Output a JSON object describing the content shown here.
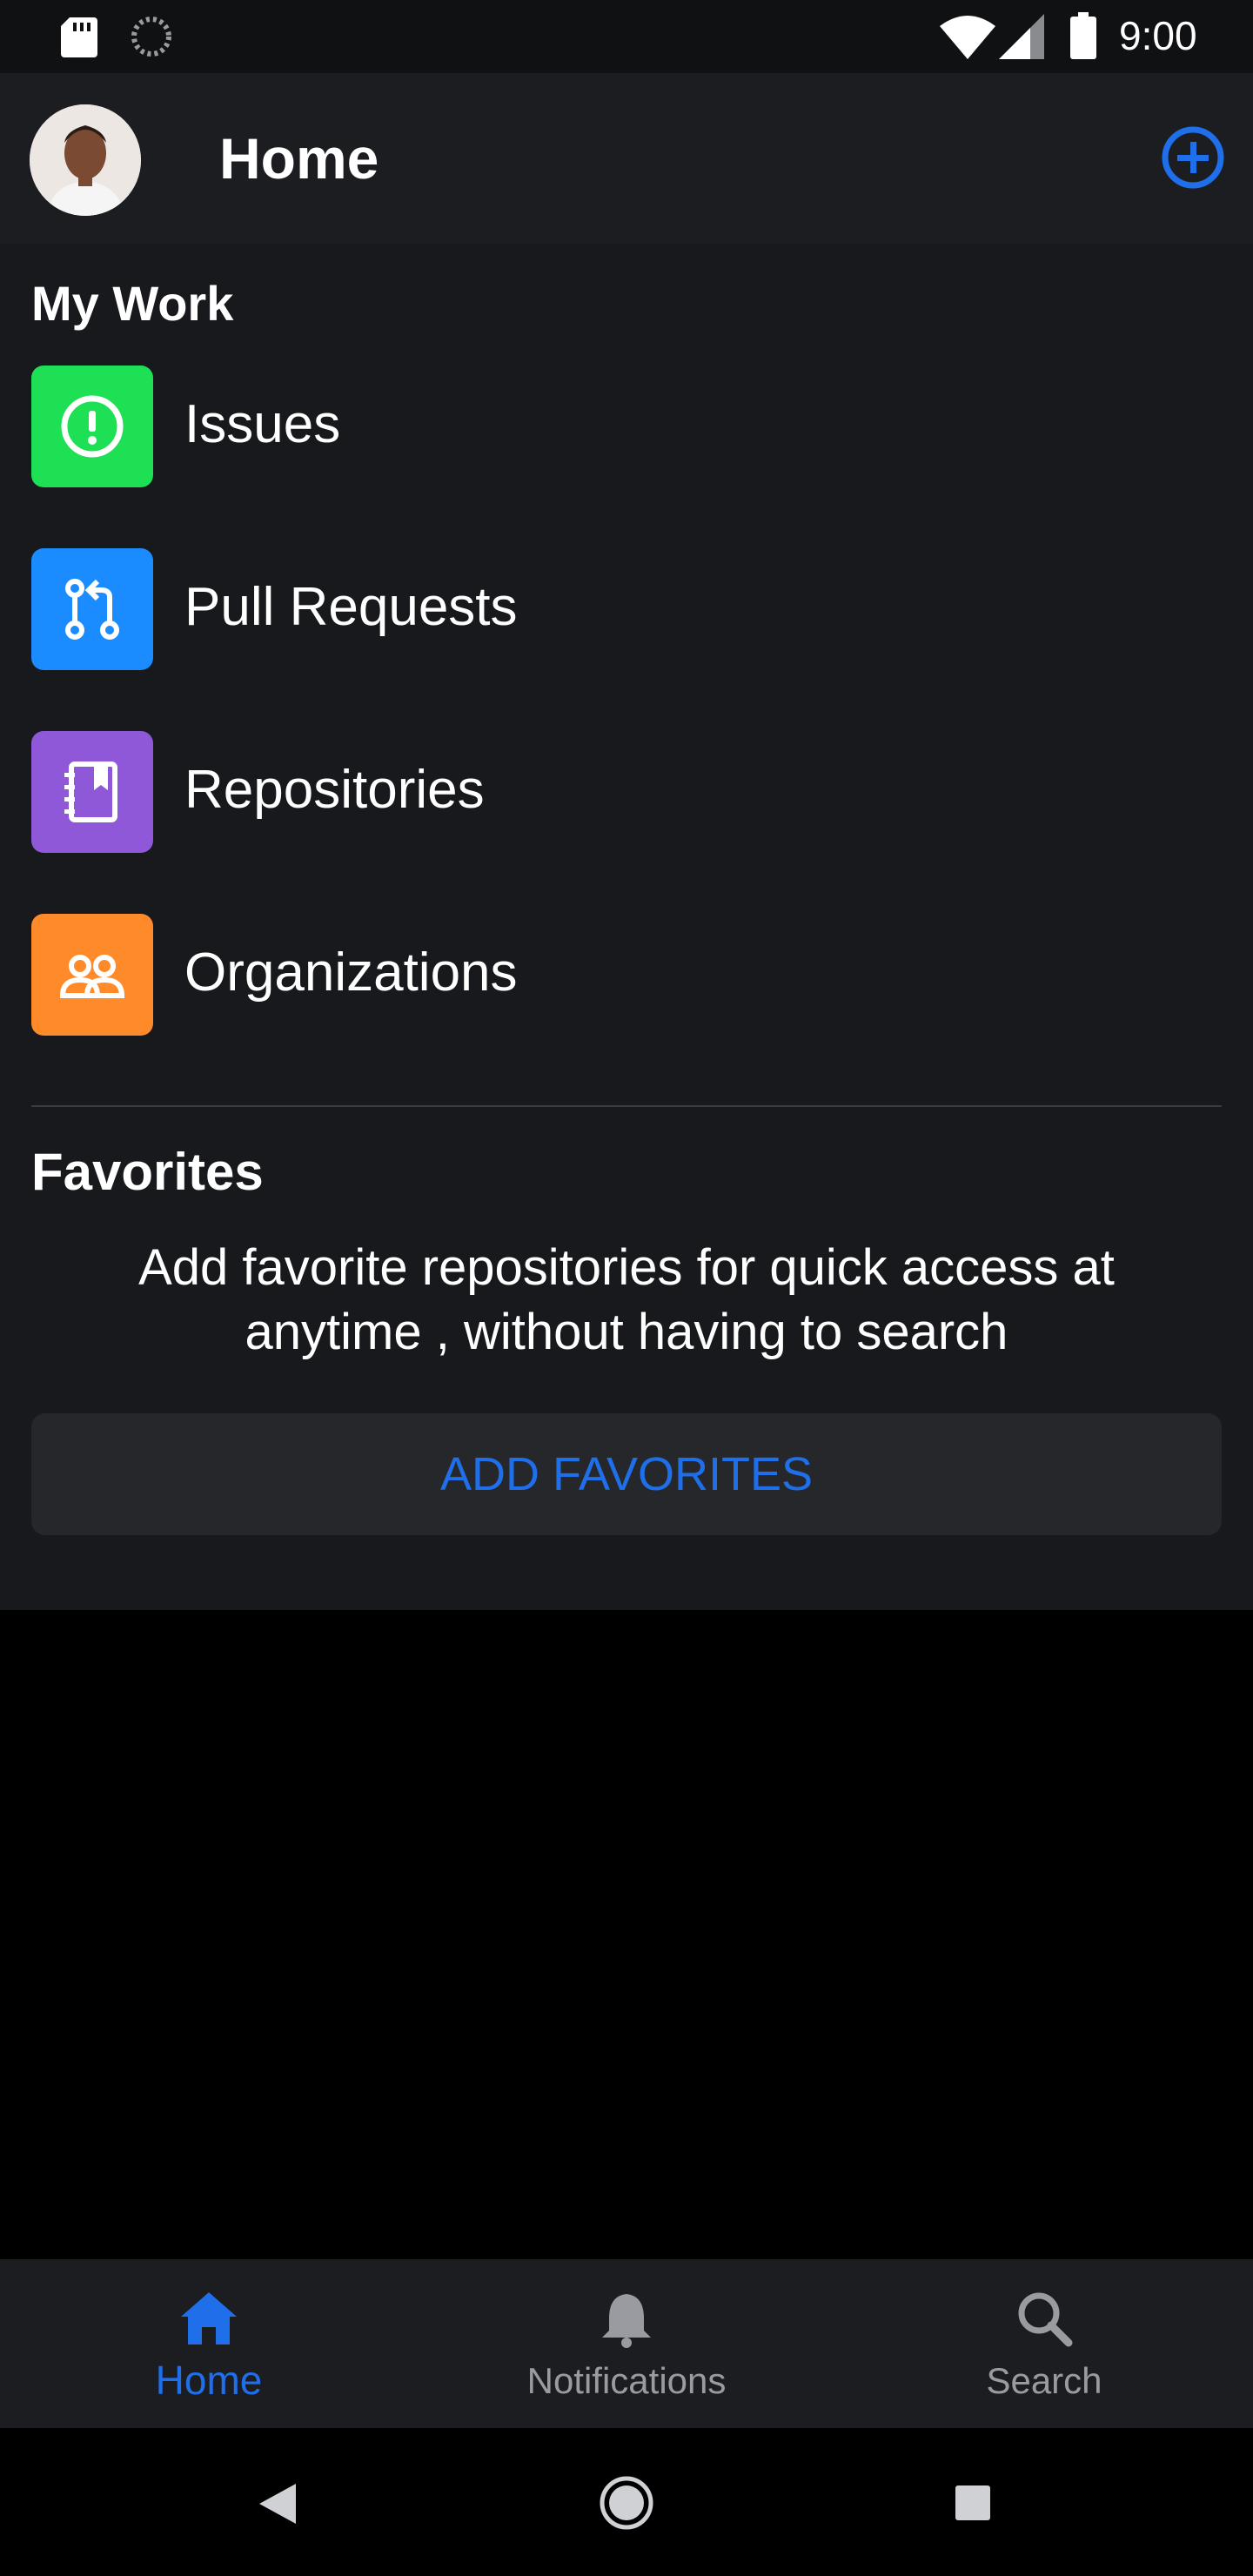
{
  "status_bar": {
    "time": "9:00",
    "icons": [
      "sd-card-icon",
      "loading-icon",
      "wifi-icon",
      "signal-icon",
      "battery-icon"
    ]
  },
  "header": {
    "title": "Home",
    "avatar": "user-avatar",
    "add_icon": "plus-circle-icon"
  },
  "my_work": {
    "title": "My Work",
    "items": [
      {
        "label": "Issues",
        "icon": "issue-icon",
        "color": "#1ee054"
      },
      {
        "label": "Pull Requests",
        "icon": "pull-request-icon",
        "color": "#1a8cff"
      },
      {
        "label": "Repositories",
        "icon": "repo-icon",
        "color": "#8e58d8"
      },
      {
        "label": "Organizations",
        "icon": "organization-icon",
        "color": "#ff8a2a"
      }
    ]
  },
  "favorites": {
    "title": "Favorites",
    "description": "Add favorite repositories for quick access at anytime , without having to search",
    "button_label": "ADD FAVORITES"
  },
  "bottom_nav": {
    "items": [
      {
        "label": "Home",
        "icon": "home-icon",
        "active": true
      },
      {
        "label": "Notifications",
        "icon": "bell-icon",
        "active": false
      },
      {
        "label": "Search",
        "icon": "search-icon",
        "active": false
      }
    ]
  },
  "system_nav": {
    "icons": [
      "back-icon",
      "home-circle-icon",
      "recents-icon"
    ]
  },
  "colors": {
    "accent": "#1f6feb",
    "background": "#18191c",
    "header": "#1c1d21"
  }
}
